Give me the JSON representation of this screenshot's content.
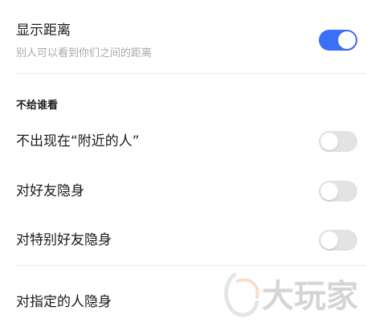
{
  "show_distance": {
    "title": "显示距离",
    "subtitle": "别人可以看到你们之间的距离",
    "enabled": true
  },
  "hide_from": {
    "header": "不给谁看",
    "items": [
      {
        "label": "不出现在“附近的人”",
        "enabled": false
      },
      {
        "label": "对好友隐身",
        "enabled": false
      },
      {
        "label": "对特别好友隐身",
        "enabled": false
      },
      {
        "label": "对指定的人隐身"
      }
    ]
  },
  "watermark": {
    "text": "大玩家"
  },
  "colors": {
    "accent": "#3b6ff5",
    "toggle_off": "#e3e3e3",
    "subtitle": "#a9a9a9"
  }
}
